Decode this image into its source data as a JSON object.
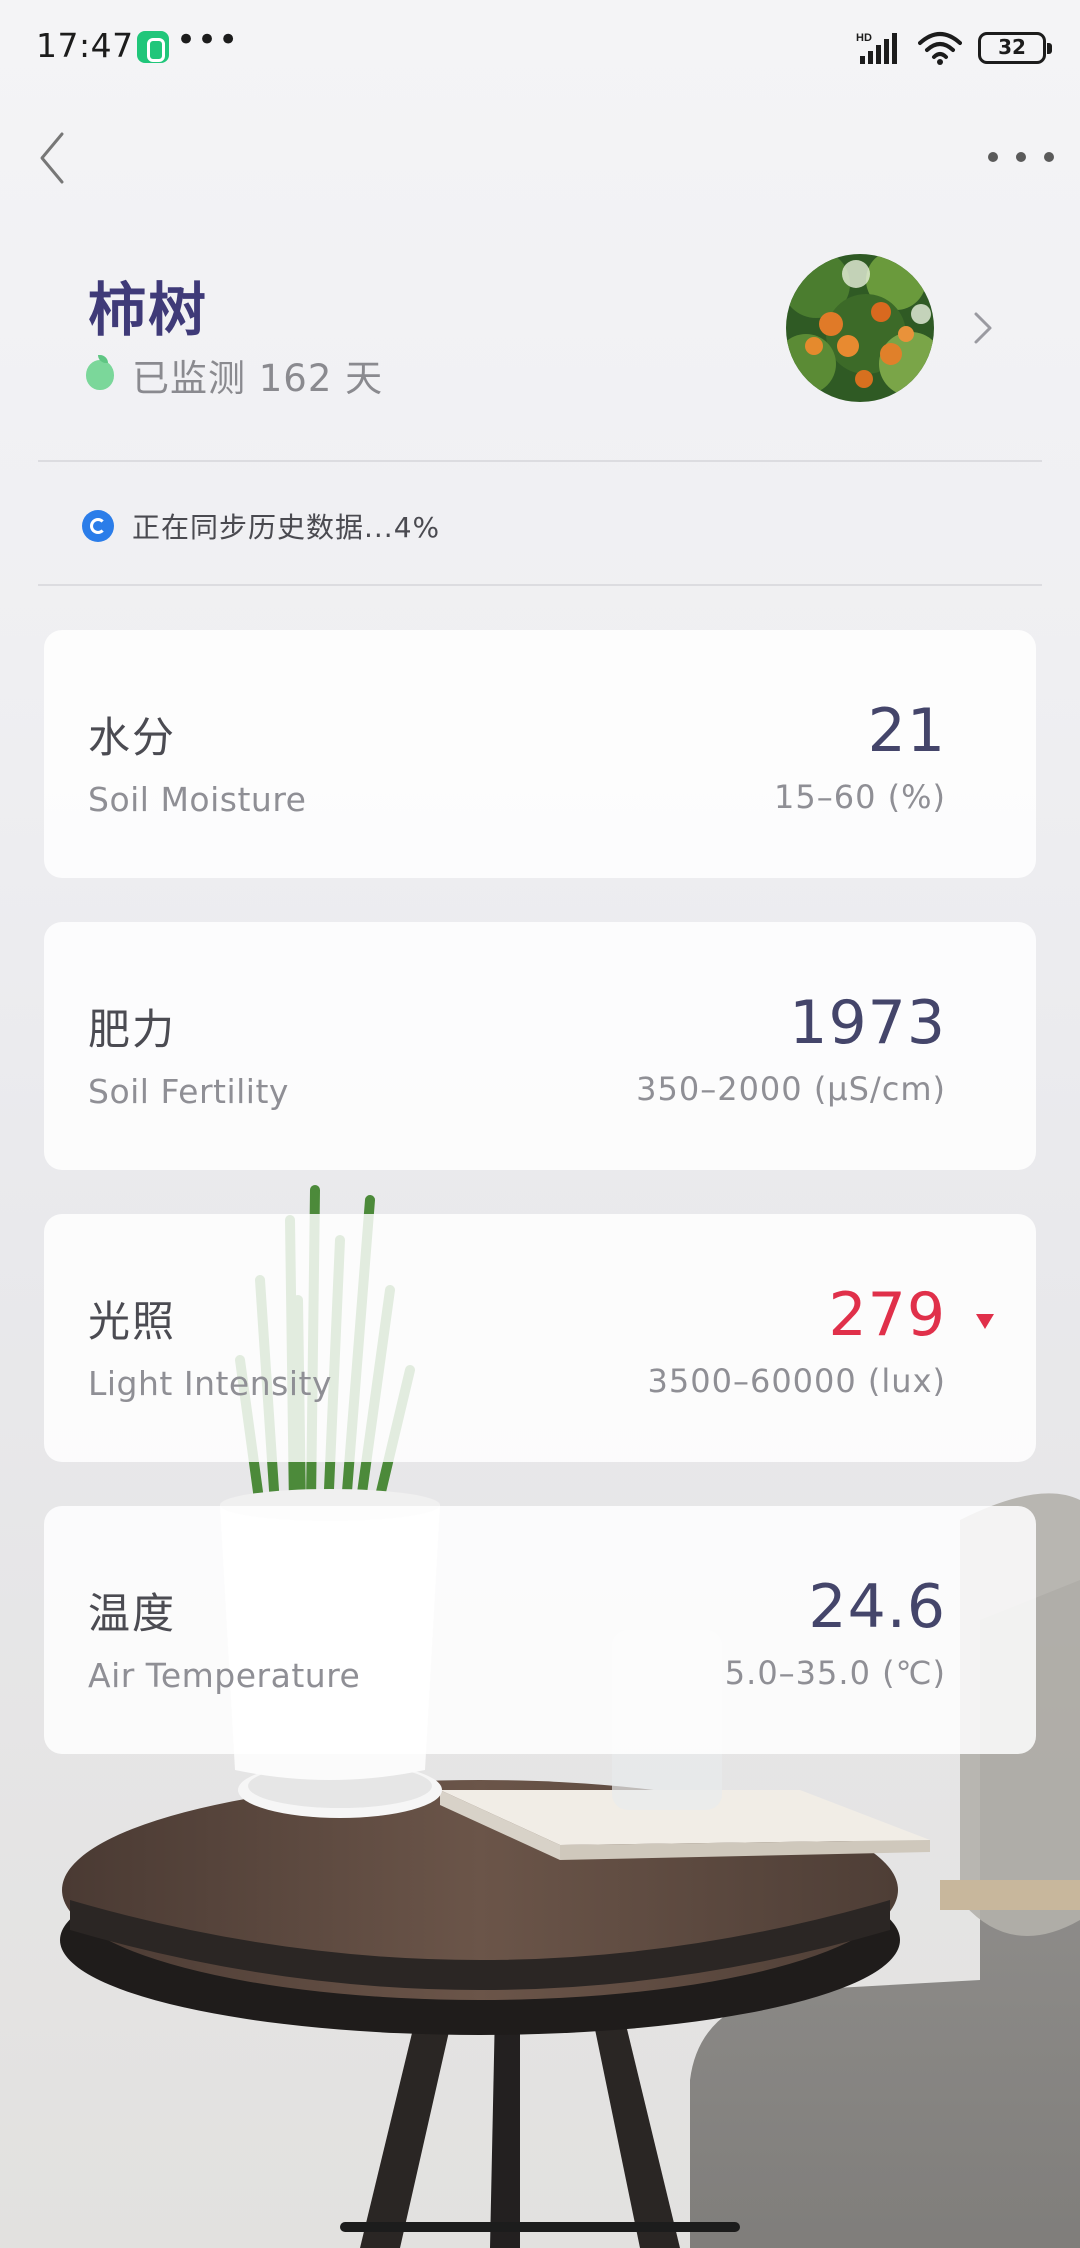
{
  "status_bar": {
    "time": "17:47",
    "dots": "•••",
    "network_label": "HD",
    "battery": "32"
  },
  "header": {
    "plant_name": "柿树",
    "monitor_text": "已监测 162 天"
  },
  "sync": {
    "text": "正在同步历史数据...4%",
    "progress_percent": 4
  },
  "metrics": [
    {
      "title": "水分",
      "subtitle": "Soil Moisture",
      "value": "21",
      "range": "15–60 (%)",
      "alert": false
    },
    {
      "title": "肥力",
      "subtitle": "Soil Fertility",
      "value": "1973",
      "range": "350–2000 (μS/cm)",
      "alert": false
    },
    {
      "title": "光照",
      "subtitle": "Light Intensity",
      "value": "279",
      "range": "3500–60000 (lux)",
      "alert": true
    },
    {
      "title": "温度",
      "subtitle": "Air Temperature",
      "value": "24.6",
      "range": "5.0–35.0 (℃)",
      "alert": false
    }
  ],
  "colors": {
    "plant_name": "#3f3a78",
    "value": "#44456a",
    "alert": "#e0304a",
    "sync_icon": "#2b7de9",
    "monitor_icon": "#7bd79a"
  },
  "icons": {
    "back": "chevron-left-icon",
    "more": "more-dots-icon",
    "avatar_chevron": "chevron-right-icon",
    "sync": "sync-icon",
    "monitor": "leaf-icon",
    "alert": "triangle-down-icon"
  }
}
